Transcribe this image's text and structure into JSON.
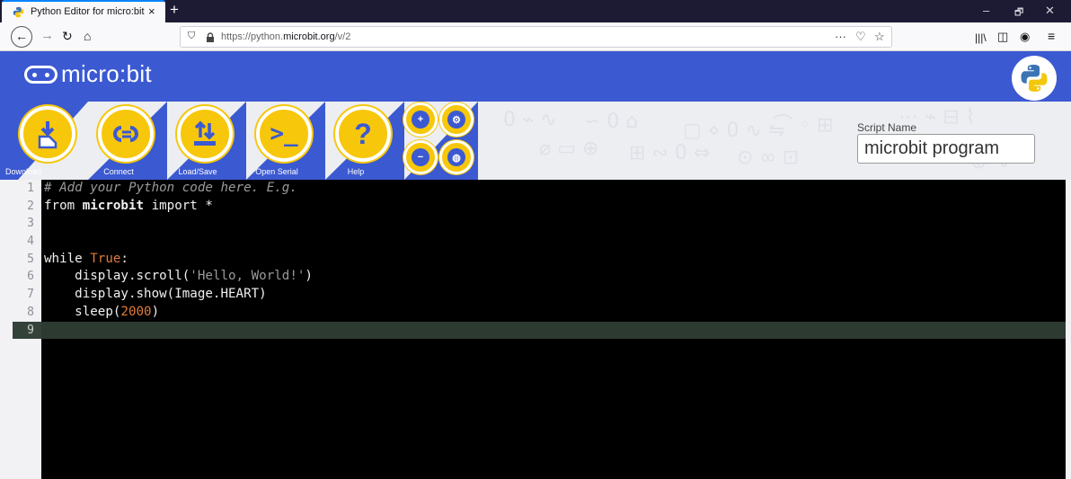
{
  "browser": {
    "tab_title": "Python Editor for micro:bit",
    "tab_close": "×",
    "new_tab": "+",
    "window_controls": [
      "–",
      "🗗",
      "✕"
    ],
    "url_prefix": "https://python.",
    "url_domain": "microbit.org",
    "url_path": "/v/2",
    "url_actions": [
      "···",
      "♡",
      "☆"
    ]
  },
  "app": {
    "logo_text": "micro:bit",
    "tools": [
      {
        "label": "Download",
        "icon": "download-icon",
        "glyph": "⭳"
      },
      {
        "label": "Connect",
        "icon": "connect-icon",
        "glyph": "C⇒"
      },
      {
        "label": "Load/Save",
        "icon": "load-save-icon",
        "glyph": "⇅"
      },
      {
        "label": "Open Serial",
        "icon": "serial-icon",
        "glyph": ">_"
      },
      {
        "label": "Help",
        "icon": "help-icon",
        "glyph": "?"
      }
    ],
    "mini_tools": [
      {
        "icon": "zoom-in-icon",
        "glyph": "+"
      },
      {
        "icon": "settings-icon",
        "glyph": "⚙"
      },
      {
        "icon": "zoom-out-icon",
        "glyph": "−"
      },
      {
        "icon": "language-icon",
        "glyph": "◍"
      }
    ],
    "script_name_label": "Script Name",
    "script_name_value": "microbit program"
  },
  "editor": {
    "line_numbers": [
      "1",
      "2",
      "3",
      "4",
      "5",
      "6",
      "7",
      "8",
      "9"
    ],
    "active_line": 9,
    "lines": [
      [
        {
          "t": "# Add your Python code here. E.g.",
          "c": "cm-comment"
        }
      ],
      [
        {
          "t": "from ",
          "c": "cm-kw"
        },
        {
          "t": "microbit",
          "c": "cm-bold"
        },
        {
          "t": " import *",
          "c": "cm-kw"
        }
      ],
      [],
      [],
      [
        {
          "t": "while ",
          "c": "cm-kw"
        },
        {
          "t": "True",
          "c": "cm-const"
        },
        {
          "t": ":",
          "c": "cm-kw"
        }
      ],
      [
        {
          "t": "    display.scroll(",
          "c": "cm-kw"
        },
        {
          "t": "'Hello, World!'",
          "c": "cm-str"
        },
        {
          "t": ")",
          "c": "cm-kw"
        }
      ],
      [
        {
          "t": "    display.show(Image.HEART)",
          "c": "cm-kw"
        }
      ],
      [
        {
          "t": "    sleep(",
          "c": "cm-kw"
        },
        {
          "t": "2000",
          "c": "cm-num"
        },
        {
          "t": ")",
          "c": "cm-kw"
        }
      ],
      []
    ]
  },
  "colors": {
    "brand_blue": "#3b59d1",
    "accent_yellow": "#f7c70b"
  }
}
